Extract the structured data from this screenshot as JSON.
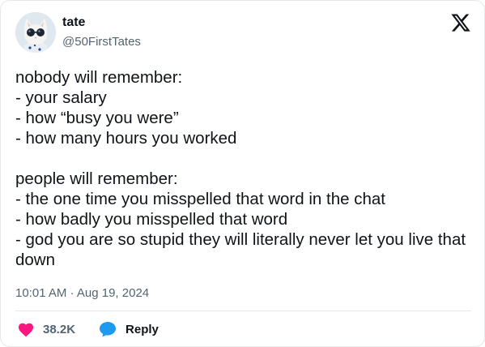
{
  "author": {
    "name": "tate",
    "handle": "@50FirstTates",
    "avatar_icon": "cat-with-sunglasses-avatar"
  },
  "brand_icon": "x-logo-icon",
  "tweet": {
    "lines": [
      "nobody will remember:",
      "- your salary",
      "- how “busy you were”",
      "- how many hours you worked",
      "",
      "people will remember:",
      "- the one time you misspelled that word in the chat",
      "- how badly you misspelled that word",
      "- god you are so stupid they will literally never let you live that down"
    ],
    "timestamp": "10:01 AM · Aug 19, 2024"
  },
  "actions": {
    "likes_count": "38.2K",
    "reply_label": "Reply"
  },
  "colors": {
    "like": "#f91880",
    "reply": "#1d9bf0",
    "secondary_text": "#536471",
    "primary_text": "#0f1419"
  }
}
